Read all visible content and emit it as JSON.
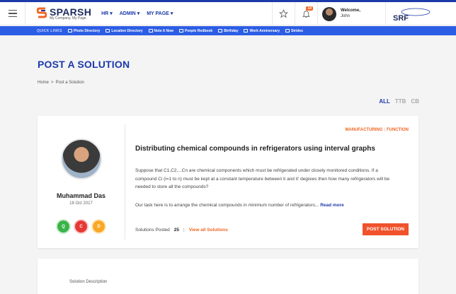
{
  "header": {
    "logo_title": "SPARSH",
    "logo_subtitle": "My Company. My Page.",
    "nav": [
      {
        "label": "HR"
      },
      {
        "label": "ADMIN"
      },
      {
        "label": "MY PAGE"
      }
    ],
    "notification_count": "14",
    "welcome_label": "Welcome,",
    "user_name": "John",
    "brand_logo": "SRF"
  },
  "quick_links": {
    "title": "QUICK LINKS",
    "items": [
      {
        "label": "Photo Directory",
        "icon": "photo-icon"
      },
      {
        "label": "Location Directory",
        "icon": "folder-icon"
      },
      {
        "label": "Note It Now",
        "icon": "note-icon"
      },
      {
        "label": "People Redbook",
        "icon": "book-icon"
      },
      {
        "label": "Birthday",
        "icon": "cake-icon"
      },
      {
        "label": "Work Anniversary",
        "icon": "gift-icon"
      },
      {
        "label": "Strides",
        "icon": "strides-icon"
      }
    ]
  },
  "page": {
    "title": "POST A SOLUTION",
    "breadcrumb": {
      "home": "Home",
      "separator": ">",
      "current": "Post a Solution"
    }
  },
  "filters": [
    {
      "label": "ALL",
      "active": true
    },
    {
      "label": "TTB",
      "active": false
    },
    {
      "label": "CB",
      "active": false
    }
  ],
  "problem": {
    "author": "Muhammad Das",
    "date": "18 Oct 2017",
    "tags": [
      "Q",
      "C",
      "D"
    ],
    "category": "MANUFACTURING",
    "category_sep": "|",
    "category2": "FUNCTION",
    "title": "Distributing chemical compounds in refrigerators using interval graphs",
    "description": "Suppose that C1,C2,...Cn are chemical components which must be refrigerated under closely monitored conditions. If a compound Ci (i=1 to n) must be kept at a constant temperature between ti and ti' degrees then how many refrigerators will be needed to store all the compounds?",
    "task": "Our task here is to arrange the chemical compounds in minimum number of refrigerators...",
    "read_more": "Read more",
    "solutions_label": "Solutions Posted",
    "solutions_count": "25",
    "pipe": "|",
    "view_all": "View all Solutions",
    "post_button": "POST SOLUTION"
  },
  "solution_form": {
    "label": "Solution Description"
  },
  "colors": {
    "brand_blue": "#1c3aa9",
    "quicklinks_bar": "#2c5de5",
    "accent_orange": "#f26522",
    "button_red": "#f0522b"
  }
}
